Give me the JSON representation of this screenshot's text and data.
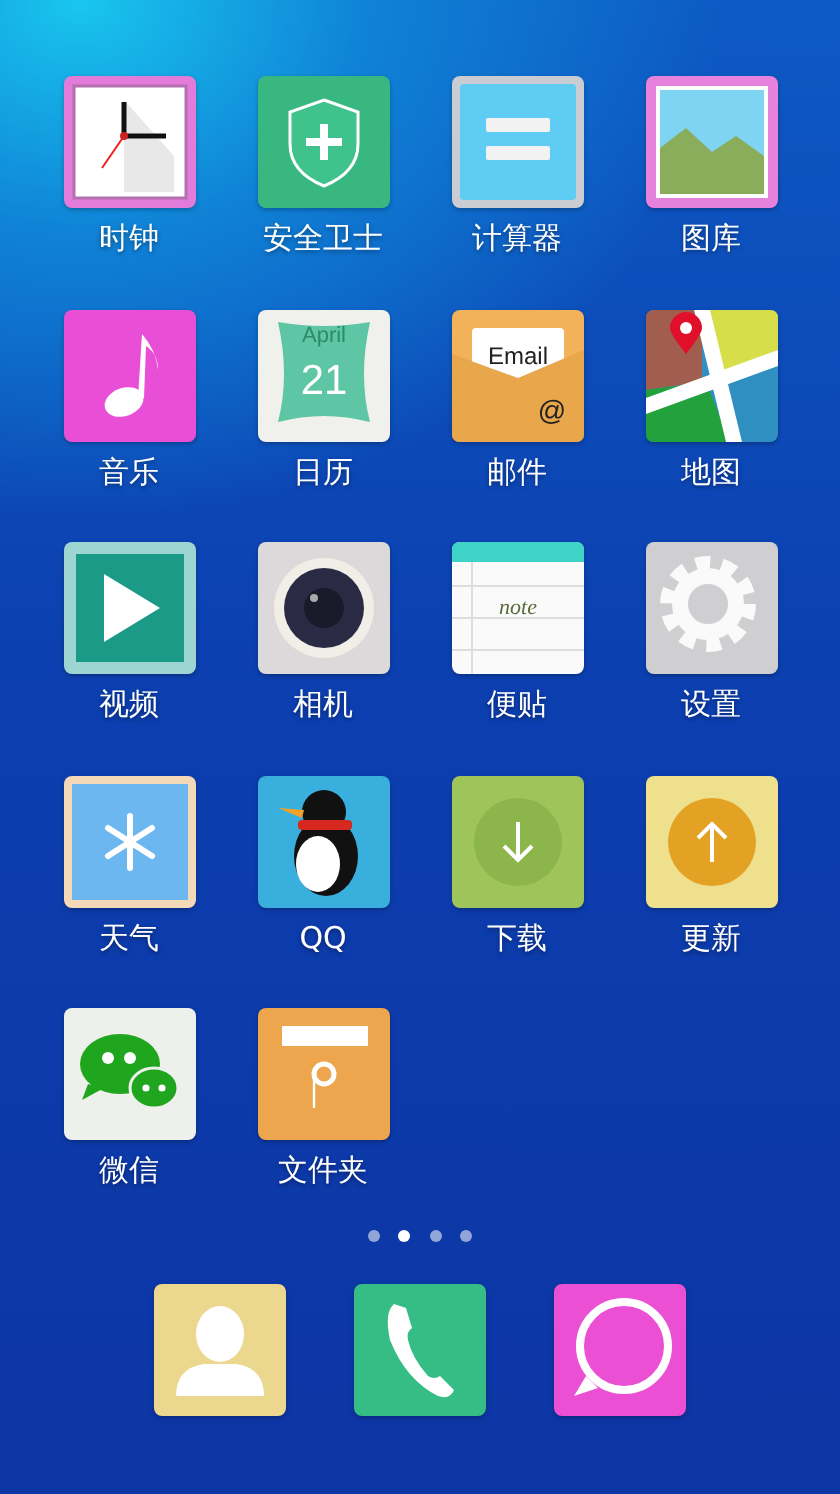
{
  "apps": [
    {
      "kind": "clock",
      "label": "时钟"
    },
    {
      "kind": "shield",
      "label": "安全卫士"
    },
    {
      "kind": "calculator",
      "label": "计算器"
    },
    {
      "kind": "gallery",
      "label": "图库"
    },
    {
      "kind": "music",
      "label": "音乐"
    },
    {
      "kind": "calendar",
      "label": "日历",
      "month": "April",
      "day": "21"
    },
    {
      "kind": "mail",
      "label": "邮件",
      "card_text": "Email",
      "symbol": "@"
    },
    {
      "kind": "map",
      "label": "地图"
    },
    {
      "kind": "video",
      "label": "视频"
    },
    {
      "kind": "camera",
      "label": "相机"
    },
    {
      "kind": "notes",
      "label": "便贴",
      "note_text": "note"
    },
    {
      "kind": "settings",
      "label": "设置"
    },
    {
      "kind": "weather",
      "label": "天气"
    },
    {
      "kind": "penguin",
      "label": "QQ"
    },
    {
      "kind": "download",
      "label": "下载"
    },
    {
      "kind": "update",
      "label": "更新"
    },
    {
      "kind": "chat",
      "label": "微信"
    },
    {
      "kind": "folder",
      "label": "文件夹"
    }
  ],
  "page_indicator": [
    {
      "selected": false
    },
    {
      "selected": true
    },
    {
      "selected": false
    },
    {
      "selected": false
    }
  ],
  "dock": [
    {
      "kind": "contacts"
    },
    {
      "kind": "phone"
    },
    {
      "kind": "message"
    }
  ]
}
